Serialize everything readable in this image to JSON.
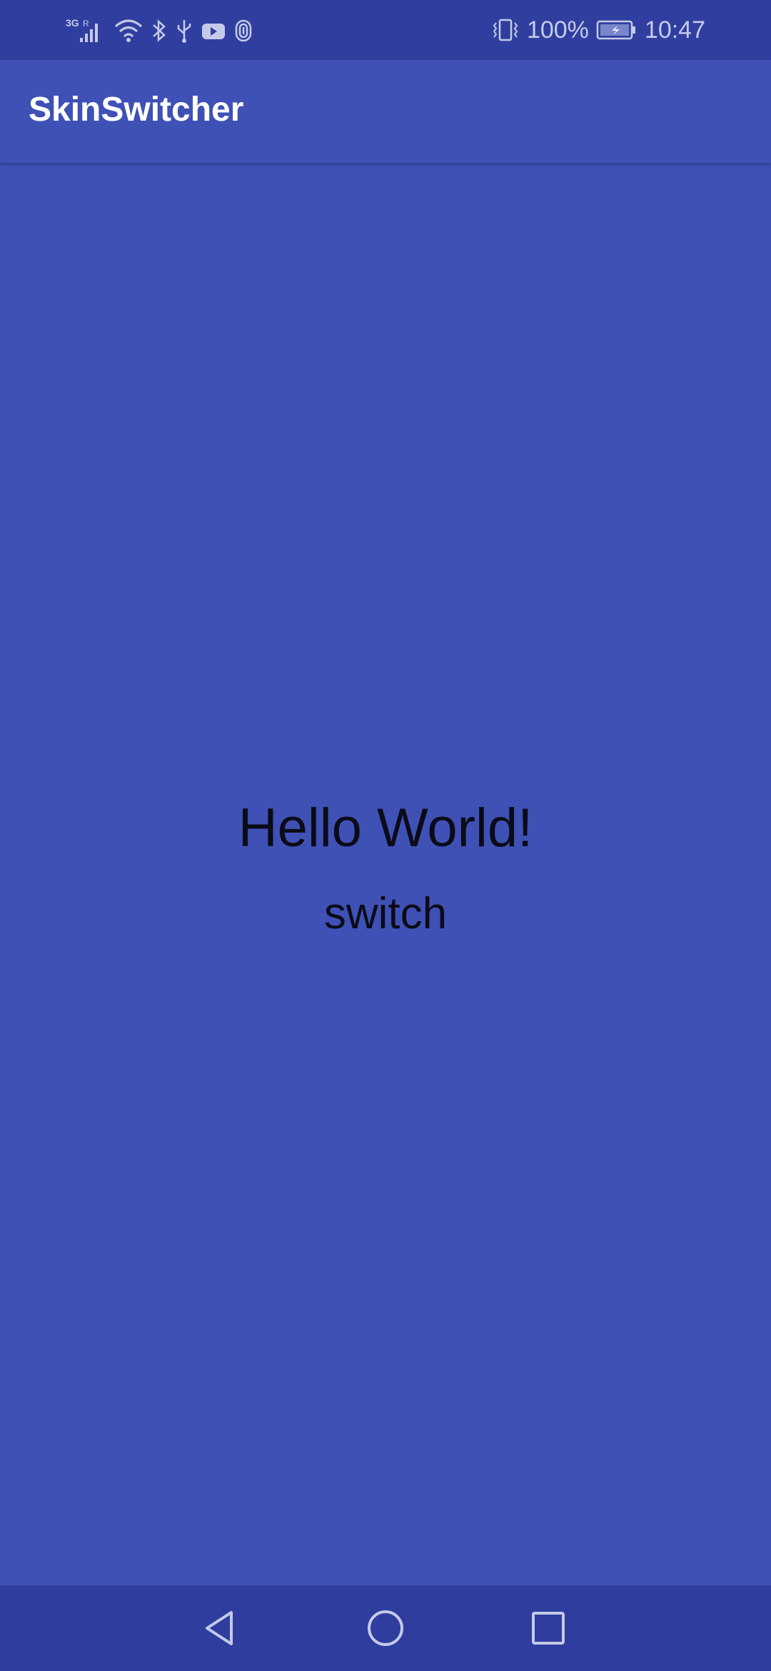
{
  "status_bar": {
    "network": "3G R",
    "battery": "100%",
    "time": "10:47",
    "icons": [
      "signal-icon",
      "wifi-icon",
      "bluetooth-icon",
      "usb-icon",
      "youtube-icon",
      "fingerprint-icon",
      "vibrate-icon",
      "battery-charging-icon"
    ]
  },
  "app_bar": {
    "title": "SkinSwitcher"
  },
  "main": {
    "hello_text": "Hello World!",
    "switch_label": "switch"
  },
  "nav_bar": {
    "icons": [
      "back-icon",
      "home-icon",
      "recents-icon"
    ]
  },
  "colors": {
    "primary": "#3f51b5",
    "primary_dark": "#303f9f",
    "text": "#0b0b18"
  }
}
